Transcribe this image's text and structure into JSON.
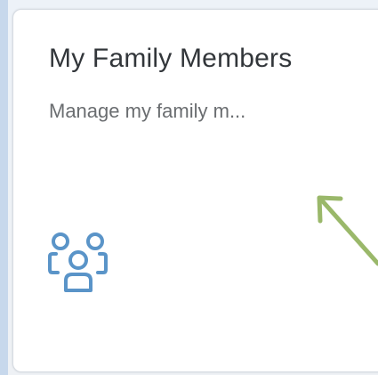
{
  "tile": {
    "title": "My Family Members",
    "subtitle": "Manage my family m..."
  },
  "icons": {
    "tile_icon": "family-members-icon",
    "annotation": "pointer-arrow"
  },
  "colors": {
    "icon": "#5a94c8",
    "annotation_arrow": "#9ab86a",
    "title_text": "#32363a",
    "subtitle_text": "#6a6d70"
  }
}
